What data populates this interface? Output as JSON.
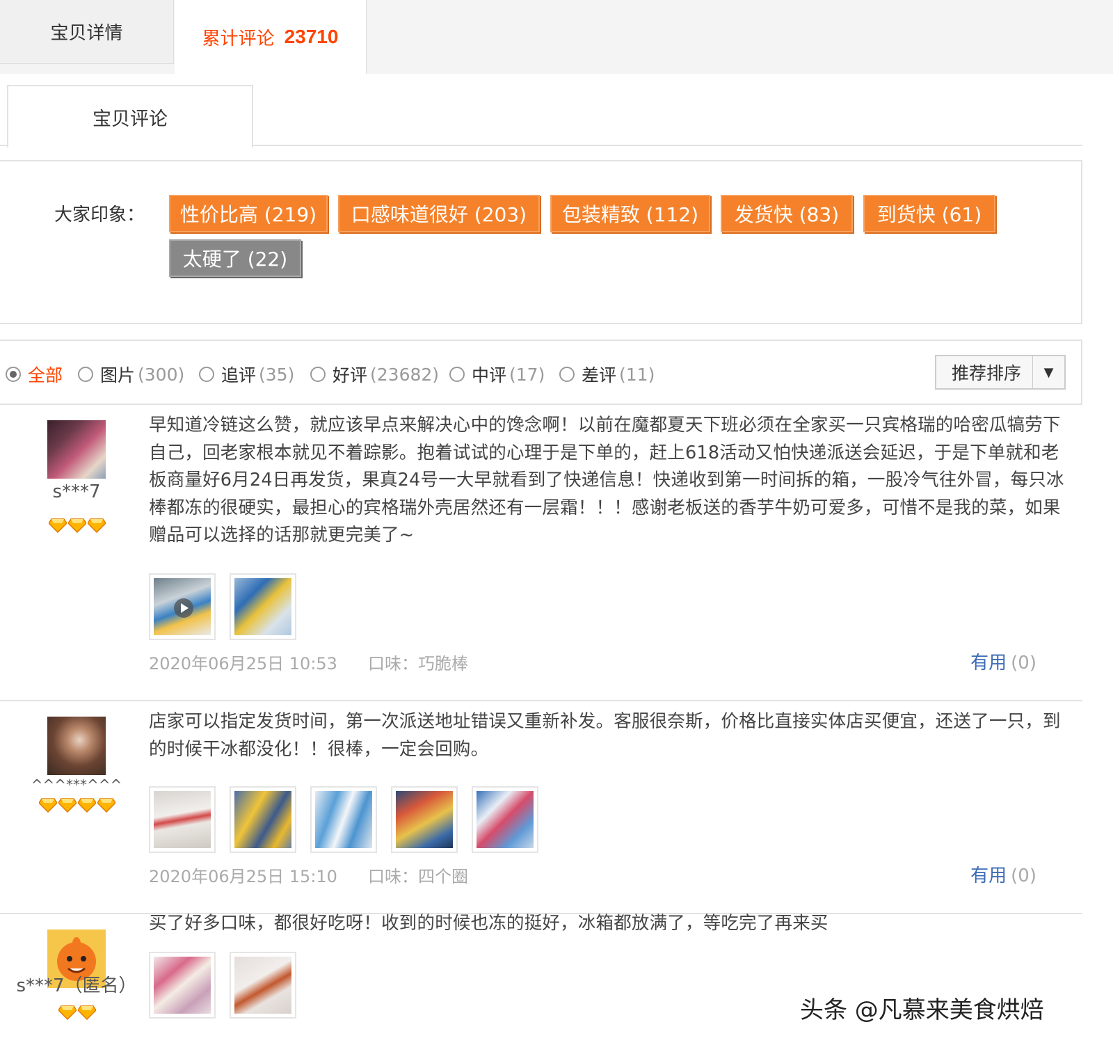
{
  "tabs": {
    "detail_label": "宝贝详情",
    "reviews_label": "累计评论",
    "reviews_count": "23710"
  },
  "sub_tab": {
    "label": "宝贝评论"
  },
  "impressions": {
    "label": "大家印象：",
    "tags": [
      {
        "text": "性价比高 (219)",
        "tone": "positive"
      },
      {
        "text": "口感味道很好 (203)",
        "tone": "positive"
      },
      {
        "text": "包装精致 (112)",
        "tone": "positive"
      },
      {
        "text": "发货快 (83)",
        "tone": "positive"
      },
      {
        "text": "到货快 (61)",
        "tone": "positive"
      },
      {
        "text": "太硬了 (22)",
        "tone": "negative"
      }
    ]
  },
  "filters": [
    {
      "label": "全部",
      "count": "",
      "selected": true
    },
    {
      "label": "图片",
      "count": "(300)",
      "selected": false
    },
    {
      "label": "追评",
      "count": "(35)",
      "selected": false
    },
    {
      "label": "好评",
      "count": "(23682)",
      "selected": false
    },
    {
      "label": "中评",
      "count": "(17)",
      "selected": false
    },
    {
      "label": "差评",
      "count": "(11)",
      "selected": false
    }
  ],
  "sort": {
    "label": "推荐排序"
  },
  "reviews": [
    {
      "user": "s***7",
      "gem_count": 3,
      "text": "早知道冷链这么赞，就应该早点来解决心中的馋念啊！以前在魔都夏天下班必须在全家买一只宾格瑞的哈密瓜犒劳下自己，回老家根本就见不着踪影。抱着试试的心理于是下单的，赶上618活动又怕快递派送会延迟，于是下单就和老板商量好6月24日再发货，果真24号一大早就看到了快递信息！快递收到第一时间拆的箱，一股冷气往外冒，每只冰棒都冻的很硬实，最担心的宾格瑞外壳居然还有一层霜！！！感谢老板送的香芋牛奶可爱多，可惜不是我的菜，如果赠品可以选择的话那就更完美了~",
      "date": "2020年06月25日 10:53",
      "flavor": "口味：巧脆棒",
      "useful_label": "有用",
      "useful_count": "(0)"
    },
    {
      "user": "^^^***^^^",
      "gem_count": 4,
      "text": "店家可以指定发货时间，第一次派送地址错误又重新补发。客服很奈斯，价格比直接实体店买便宜，还送了一只，到的时候干冰都没化！！很棒，一定会回购。",
      "date": "2020年06月25日 15:10",
      "flavor": "口味：四个圈",
      "useful_label": "有用",
      "useful_count": "(0)"
    },
    {
      "user": "s***7（匿名）",
      "gem_count": 2,
      "text": "买了好多口味，都很好吃呀！收到的时候也冻的挺好，冰箱都放满了，等吃完了再来买"
    }
  ],
  "watermark": "头条 @凡慕来美食烘焙",
  "colors": {
    "accent": "#ff4400",
    "tag_positive": "#f5822b",
    "tag_negative": "#888888",
    "link": "#3c6bb5"
  }
}
